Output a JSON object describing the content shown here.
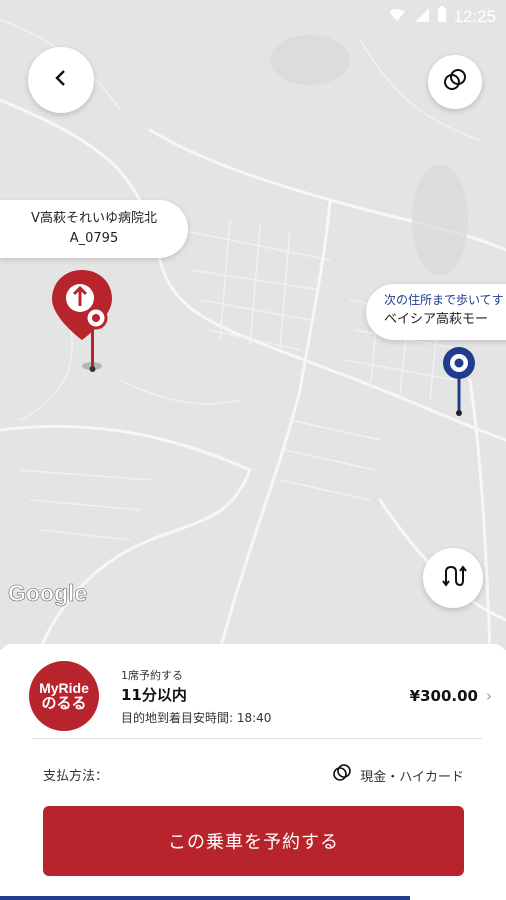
{
  "status": {
    "time": "12:25"
  },
  "map": {
    "origin_label_line1": "V高萩それいゆ病院北",
    "origin_label_line2": "A_0795",
    "dest_hint": "次の住所まで歩いてす",
    "dest_name": "ベイシア高萩モー",
    "google_logo": "Google",
    "icons": [
      "back-arrow-icon",
      "layers-icon",
      "swap-route-icon",
      "origin-pin-icon",
      "destination-pin-icon"
    ]
  },
  "ride": {
    "brand_line1": "MyRide",
    "brand_line2": "のるる",
    "tag": "1席予約する",
    "eta": "11分以内",
    "arrival": "目的地到着目安時間: 18:40",
    "price": "¥300.00",
    "chevron": "›"
  },
  "payment": {
    "label": "支払方法：",
    "method": "現金・ハイカード"
  },
  "cta": {
    "label": "この乗車を予約する"
  },
  "colors": {
    "brand_red": "#b8242c",
    "dest_blue": "#1f3d8c",
    "map_bg": "#e4e4e4"
  }
}
